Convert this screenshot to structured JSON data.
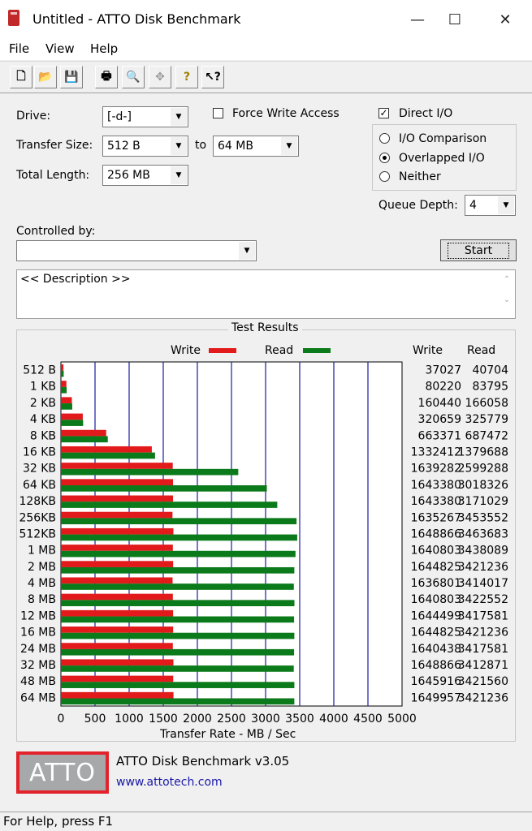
{
  "window": {
    "title": "Untitled - ATTO Disk Benchmark"
  },
  "menu": [
    "File",
    "View",
    "Help"
  ],
  "toolbar": {
    "icons": [
      "new-icon",
      "open-icon",
      "save-icon",
      "print-icon",
      "print-preview-icon",
      "move-icon",
      "help-icon",
      "context-help-icon"
    ]
  },
  "settings": {
    "drive_label": "Drive:",
    "drive_value": "[-d-]",
    "transfer_label": "Transfer Size:",
    "transfer_from": "512 B",
    "to_label": "to",
    "transfer_to": "64 MB",
    "total_label": "Total Length:",
    "total_value": "256 MB",
    "force_write_label": "Force Write Access",
    "force_write_checked": false,
    "direct_io_label": "Direct I/O",
    "direct_io_checked": true,
    "io_options": [
      "I/O Comparison",
      "Overlapped I/O",
      "Neither"
    ],
    "io_selected": "Overlapped I/O",
    "queue_label": "Queue Depth:",
    "queue_value": "4",
    "controlled_label": "Controlled by:",
    "controlled_value": "",
    "start_label": "Start",
    "description": "<< Description >>"
  },
  "results": {
    "frame_title": "Test Results",
    "write_legend": "Write",
    "read_legend": "Read",
    "write_col": "Write",
    "read_col": "Read",
    "colors": {
      "write": "#e31a1c",
      "read": "#0b7a1a",
      "grid": "#1a1aa0"
    }
  },
  "chart_data": {
    "type": "bar",
    "orientation": "horizontal",
    "categories": [
      "512 B",
      "1 KB",
      "2 KB",
      "4 KB",
      "8 KB",
      "16 KB",
      "32 KB",
      "64 KB",
      "128KB",
      "256KB",
      "512KB",
      "1 MB",
      "2 MB",
      "4 MB",
      "8 MB",
      "12 MB",
      "16 MB",
      "24 MB",
      "32 MB",
      "48 MB",
      "64 MB"
    ],
    "series": [
      {
        "name": "Write",
        "values": [
          37027,
          80220,
          160440,
          320659,
          663371,
          1332412,
          1639282,
          1643380,
          1643380,
          1635267,
          1648866,
          1640803,
          1644825,
          1636801,
          1640803,
          1644499,
          1644825,
          1640438,
          1648866,
          1645916,
          1649957
        ]
      },
      {
        "name": "Read",
        "values": [
          40704,
          83795,
          166058,
          325779,
          687472,
          1379688,
          2599288,
          3018326,
          3171029,
          3453552,
          3463683,
          3438089,
          3421236,
          3414017,
          3422552,
          3417581,
          3421236,
          3417581,
          3412871,
          3421560,
          3421236
        ]
      }
    ],
    "xlabel": "Transfer Rate - MB / Sec",
    "xlim": [
      0,
      5000
    ],
    "xticks": [
      "0",
      "500",
      "1000",
      "1500",
      "2000",
      "2500",
      "3000",
      "3500",
      "4000",
      "4500",
      "5000"
    ],
    "grid": true,
    "legend": "top"
  },
  "footer": {
    "logo_text": "ATTO",
    "product": "ATTO Disk Benchmark v3.05",
    "url": "www.attotech.com",
    "status": "For Help, press F1"
  }
}
